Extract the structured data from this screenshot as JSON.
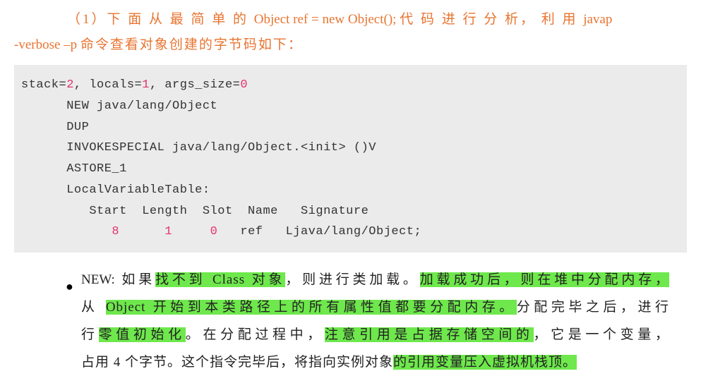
{
  "intro": {
    "prefix": "（1）下 面 从 最 简 单 的 ",
    "code_inline": "Object ref = new Object(); ",
    "mid": "代 码 进 行 分 析，  利 用 ",
    "cmd1": "javap",
    "cmd2": "-verbose –p ",
    "suffix": "命令查看对象创建的字节码如下："
  },
  "code": {
    "l1a": "stack=",
    "l1b": "2",
    "l1c": ", locals=",
    "l1d": "1",
    "l1e": ", args_size=",
    "l1f": "0",
    "l2": "      NEW java/lang/Object",
    "l3": "      DUP",
    "l4": "      INVOKESPECIAL java/lang/Object.<init> ()V",
    "l5": "      ASTORE_1",
    "l6": "      LocalVariableTable:",
    "l7": "         Start  Length  Slot  Name   Signature",
    "l8a": "            ",
    "l8b": "8",
    "l8c": "      ",
    "l8d": "1",
    "l8e": "     ",
    "l8f": "0",
    "l8g": "   ref   Ljava/lang/Object;"
  },
  "bullet": {
    "label": "NEW:",
    "t1": " 如果",
    "h1": "找不到 Class 对象",
    "t2": "，则进行类加载。",
    "h2": "加载成功后，则在堆中分配内存，",
    "t3": "从 ",
    "h3": "Object 开始到本类路径上的所有属性值都要分配内存。",
    "t4": "分配完毕之后，进行",
    "h4": "零值初始化",
    "t5": "。在分配过程中，",
    "h5": "注意引用是占据存储空间的",
    "t6": "，它是一个变量，占用 4 个字节。这个指令完毕后，将指向实例对象",
    "h6": "的引用变量压入虚拟机栈顶。"
  }
}
